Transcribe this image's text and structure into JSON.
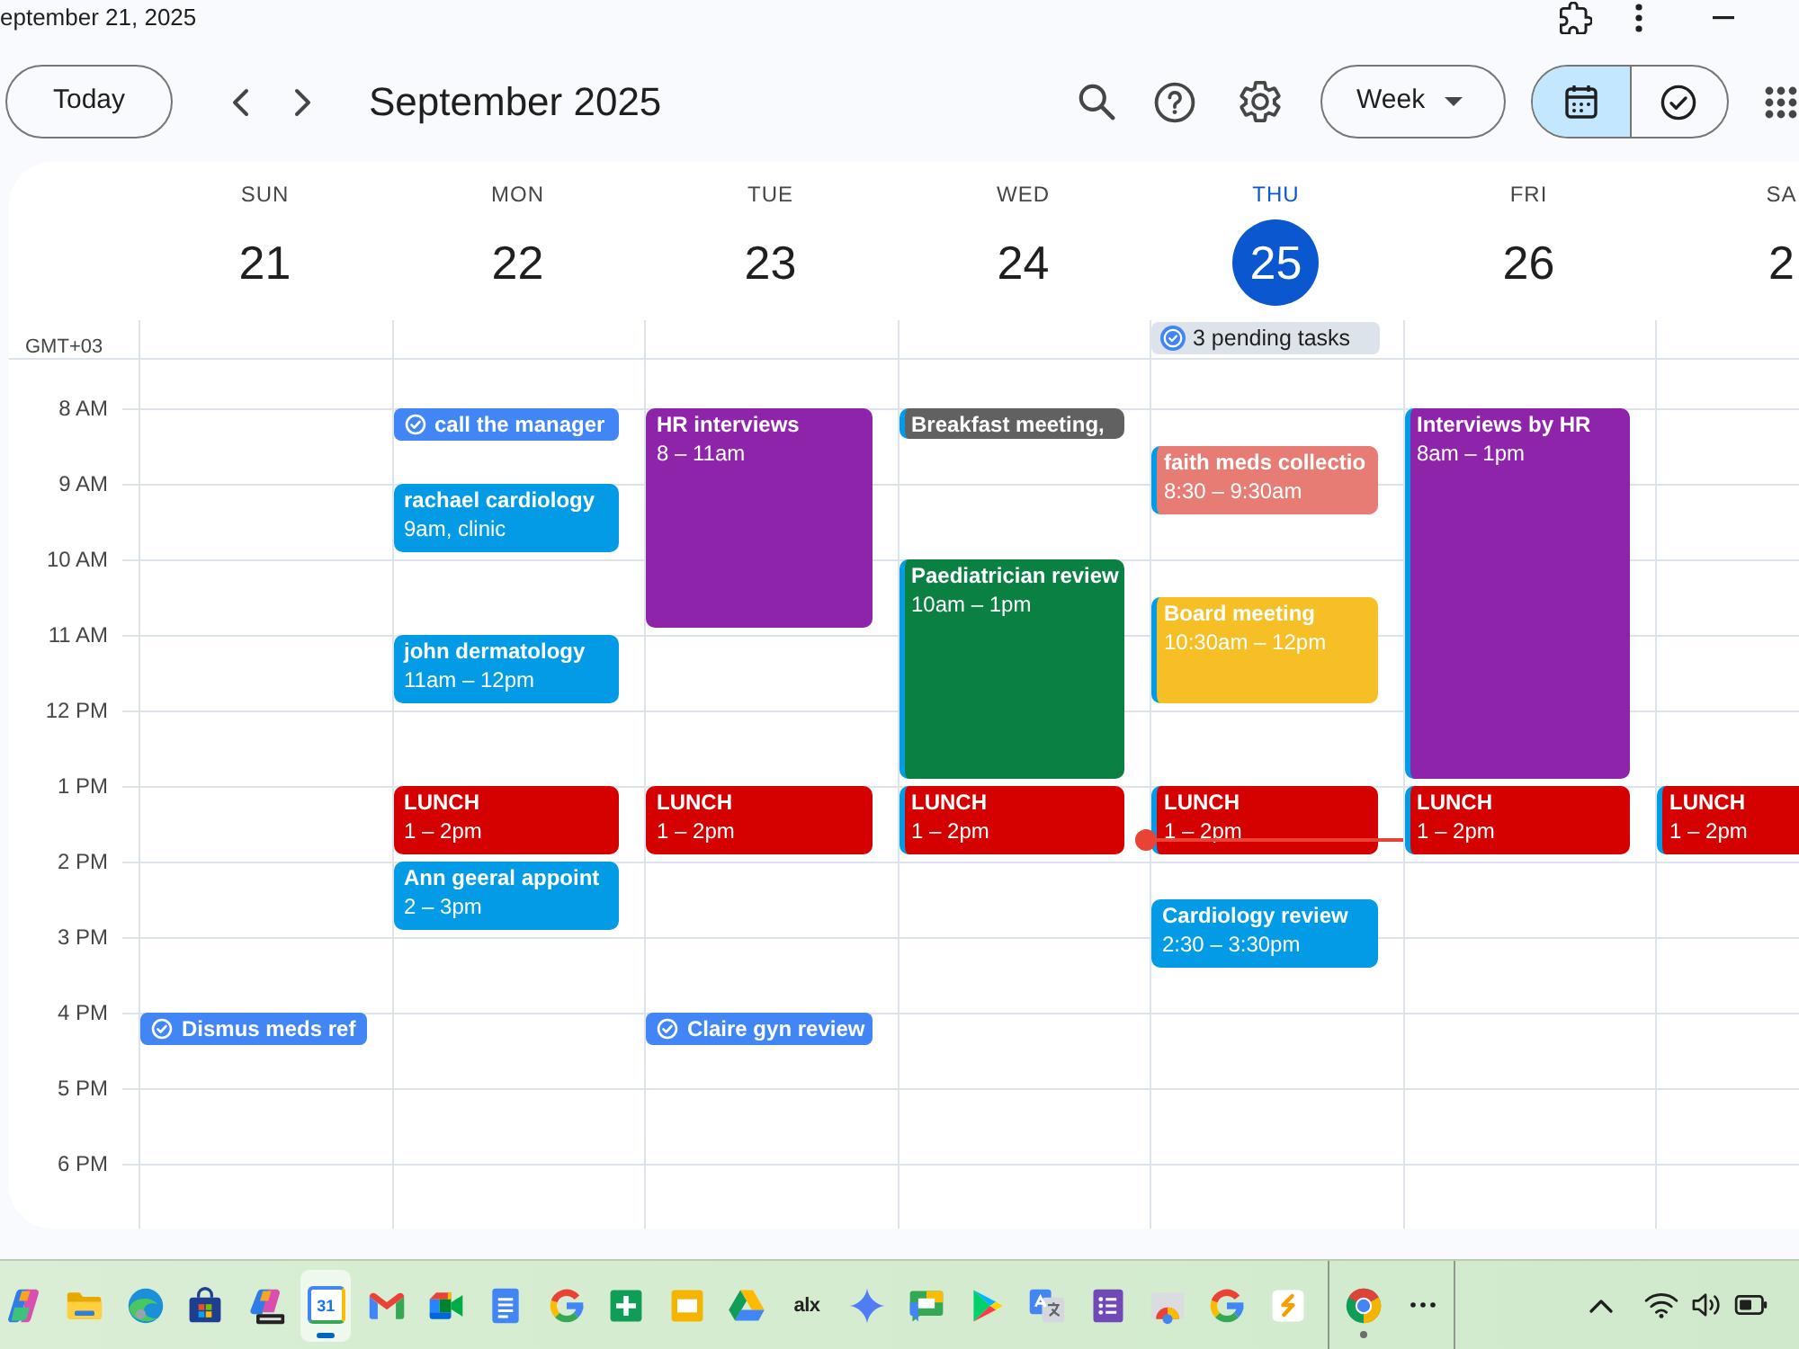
{
  "title_bar": {
    "title": "eptember 21, 2025"
  },
  "toolbar": {
    "today": "Today",
    "period": "September 2025",
    "view": "Week",
    "view_modes": [
      {
        "kind": "calendar",
        "selected": true
      },
      {
        "kind": "tasks",
        "selected": false
      }
    ]
  },
  "timezone": "GMT+03",
  "hours": [
    "8 AM",
    "9 AM",
    "10 AM",
    "11 AM",
    "12 PM",
    "1 PM",
    "2 PM",
    "3 PM",
    "4 PM",
    "5 PM",
    "6 PM"
  ],
  "days": [
    {
      "weekday": "SUN",
      "date": "21",
      "today": false,
      "events": [
        {
          "kind": "task",
          "title": "Dismus meds ref"
        }
      ]
    },
    {
      "weekday": "MON",
      "date": "22",
      "today": false,
      "events": [
        {
          "kind": "task",
          "title": "call the manager"
        },
        {
          "kind": "event",
          "title": "rachael cardiology",
          "time": "9am, clinic",
          "color": "#039be5"
        },
        {
          "kind": "event",
          "title": "john dermatology",
          "time": "11am – 12pm",
          "color": "#039be5"
        },
        {
          "kind": "event",
          "title": "LUNCH",
          "time": "1 – 2pm",
          "color": "#d50000"
        },
        {
          "kind": "event",
          "title": "Ann geeral appoint",
          "time": "2 – 3pm",
          "color": "#039be5"
        }
      ]
    },
    {
      "weekday": "TUE",
      "date": "23",
      "today": false,
      "events": [
        {
          "kind": "event",
          "title": "HR interviews",
          "time": "8 – 11am",
          "color": "#8e24aa"
        },
        {
          "kind": "event",
          "title": "LUNCH",
          "time": "1 – 2pm",
          "color": "#d50000"
        },
        {
          "kind": "task",
          "title": "Claire gyn review"
        }
      ]
    },
    {
      "weekday": "WED",
      "date": "24",
      "today": false,
      "events": [
        {
          "kind": "event",
          "title": "Breakfast meeting,",
          "color": "#616161",
          "calendar": {
            "color": "#039be5"
          }
        },
        {
          "kind": "event",
          "title": "Paediatrician review",
          "time": "10am – 1pm",
          "color": "#0b8043",
          "calendar": {
            "color": "#039be5"
          }
        },
        {
          "kind": "event",
          "title": "LUNCH",
          "time": "1 – 2pm",
          "color": "#d50000",
          "calendar": {
            "color": "#039be5"
          }
        }
      ]
    },
    {
      "weekday": "THU",
      "date": "25",
      "today": true,
      "pending_tasks": "3 pending tasks",
      "events": [
        {
          "kind": "event",
          "title": "faith meds collectio",
          "time": "8:30 – 9:30am",
          "color": "#e67c73",
          "calendar": {
            "color": "#039be5"
          }
        },
        {
          "kind": "event",
          "title": "Board meeting",
          "time": "10:30am – 12pm",
          "color": "#f6bf26",
          "calendar": {
            "color": "#039be5"
          }
        },
        {
          "kind": "event",
          "title": "LUNCH",
          "time": "1 – 2pm",
          "color": "#d50000",
          "calendar": {
            "color": "#039be5"
          }
        },
        {
          "kind": "event",
          "title": "Cardiology review",
          "time": "2:30 – 3:30pm",
          "color": "#039be5"
        }
      ]
    },
    {
      "weekday": "FRI",
      "date": "26",
      "today": false,
      "events": [
        {
          "kind": "event",
          "title": "Interviews by HR",
          "time": "8am – 1pm",
          "color": "#8e24aa",
          "calendar": {
            "color": "#039be5"
          }
        },
        {
          "kind": "event",
          "title": "LUNCH",
          "time": "1 – 2pm",
          "color": "#d50000",
          "calendar": {
            "color": "#039be5"
          }
        }
      ]
    },
    {
      "weekday": "SA",
      "date": "2",
      "today": false,
      "events": [
        {
          "kind": "event",
          "title": "LUNCH",
          "time": "1 – 2pm",
          "color": "#d50000",
          "calendar": {
            "color": "#039be5"
          }
        }
      ]
    }
  ],
  "taskbar": {
    "pinned": [
      {
        "kind": "swirl",
        "selected": false,
        "running": false
      },
      {
        "kind": "folder",
        "selected": false,
        "running": false
      },
      {
        "kind": "wave",
        "selected": false,
        "running": false
      },
      {
        "kind": "store",
        "selected": false,
        "running": false
      },
      {
        "kind": "swirlbadge",
        "selected": false,
        "running": false
      },
      {
        "kind": "calendar",
        "label": "31",
        "selected": true,
        "running": true
      },
      {
        "kind": "envelope",
        "selected": false,
        "running": false
      },
      {
        "kind": "camera",
        "selected": false,
        "running": false
      },
      {
        "kind": "document",
        "selected": false,
        "running": false
      },
      {
        "kind": "ring",
        "selected": false,
        "running": false
      },
      {
        "kind": "sheet",
        "selected": false,
        "running": false
      },
      {
        "kind": "slides",
        "selected": false,
        "running": false
      },
      {
        "kind": "drive",
        "selected": false,
        "running": false
      },
      {
        "kind": "text",
        "label": "alx",
        "selected": false,
        "running": false
      },
      {
        "kind": "sparkle",
        "selected": false,
        "running": false
      },
      {
        "kind": "chat",
        "selected": false,
        "running": false
      },
      {
        "kind": "play",
        "selected": false,
        "running": false
      },
      {
        "kind": "translate",
        "selected": false,
        "running": false
      },
      {
        "kind": "form",
        "selected": false,
        "running": false
      },
      {
        "kind": "remote",
        "selected": false,
        "running": false
      },
      {
        "kind": "ring",
        "selected": false,
        "running": false
      },
      {
        "kind": "squiggle",
        "selected": false,
        "running": false
      }
    ],
    "open": [
      {
        "kind": "browser",
        "selected": false,
        "running": true
      }
    ]
  }
}
